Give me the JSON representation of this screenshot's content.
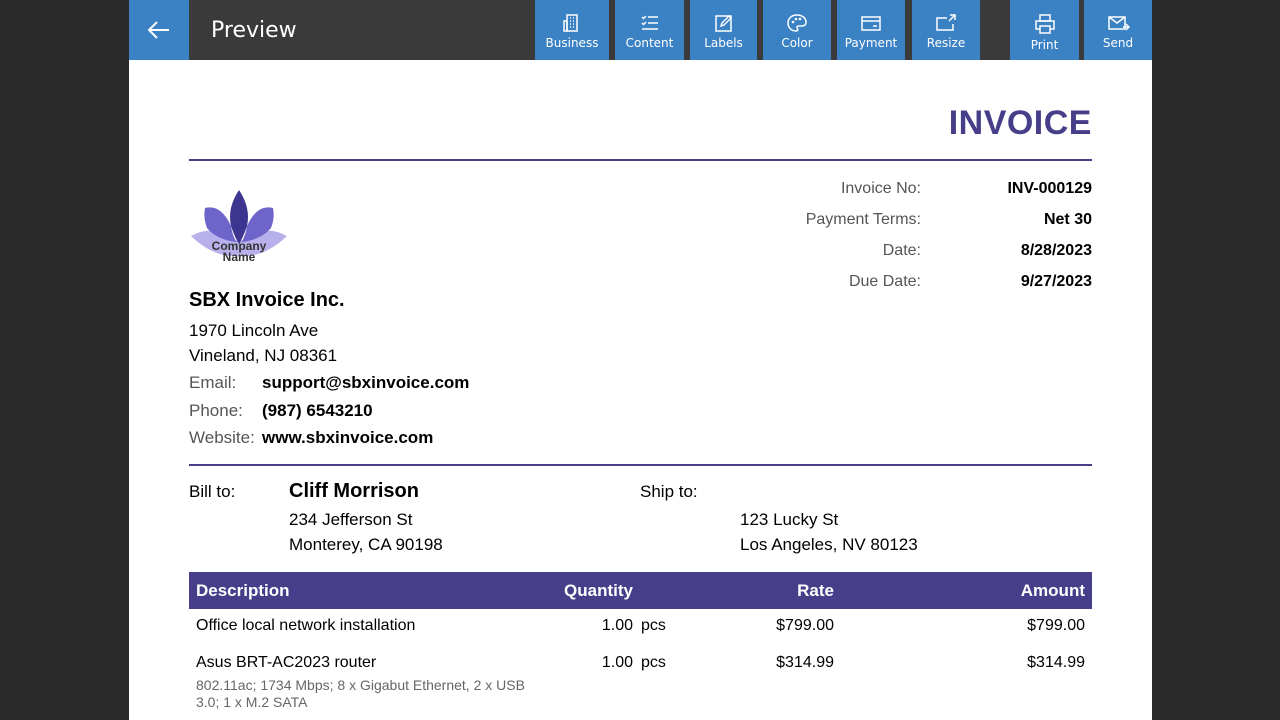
{
  "toolbar": {
    "title": "Preview",
    "buttons": {
      "business": "Business",
      "content": "Content",
      "labels": "Labels",
      "color": "Color",
      "payment": "Payment",
      "resize": "Resize",
      "print": "Print",
      "send": "Send"
    },
    "accent_color": "#3b82c4"
  },
  "invoice": {
    "heading": "INVOICE",
    "brand_color": "#473e8a",
    "meta": [
      {
        "label": "Invoice No:",
        "value": "INV-000129"
      },
      {
        "label": "Payment Terms:",
        "value": "Net 30"
      },
      {
        "label": "Date:",
        "value": "8/28/2023"
      },
      {
        "label": "Due Date:",
        "value": "9/27/2023"
      }
    ],
    "logo_text": [
      "Company",
      "Name"
    ],
    "company": {
      "name": "SBX Invoice Inc.",
      "address_line1": "1970 Lincoln Ave",
      "address_line2": "Vineland, NJ 08361",
      "email_label": "Email:",
      "email": "support@sbxinvoice.com",
      "phone_label": "Phone:",
      "phone": "(987) 6543210",
      "website_label": "Website:",
      "website": "www.sbxinvoice.com"
    },
    "bill_to": {
      "label": "Bill to:",
      "name": "Cliff Morrison",
      "address_line1": "234 Jefferson St",
      "address_line2": "Monterey, CA 90198"
    },
    "ship_to": {
      "label": "Ship to:",
      "address_line1": "123 Lucky St",
      "address_line2": "Los Angeles, NV 80123"
    },
    "table": {
      "headers": {
        "description": "Description",
        "quantity": "Quantity",
        "rate": "Rate",
        "amount": "Amount"
      },
      "rows": [
        {
          "description": "Office local network installation",
          "quantity": "1.00",
          "unit": "pcs",
          "rate": "$799.00",
          "amount": "$799.00",
          "detail": ""
        },
        {
          "description": "Asus BRT-AC2023 router",
          "quantity": "1.00",
          "unit": "pcs",
          "rate": "$314.99",
          "amount": "$314.99",
          "detail": "802.11ac; 1734 Mbps; 8 x Gigabut Ethernet, 2 x USB 3.0; 1 x M.2 SATA"
        }
      ]
    }
  }
}
